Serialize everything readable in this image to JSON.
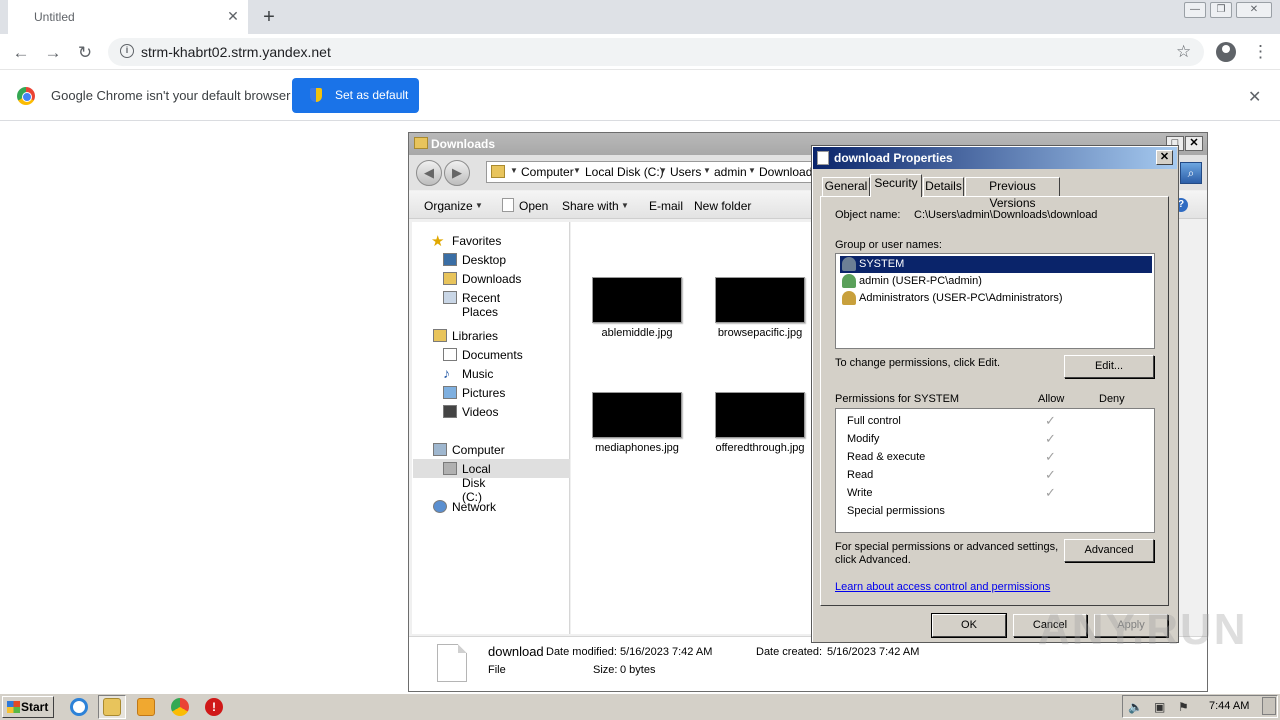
{
  "browser": {
    "tab_title": "Untitled",
    "tab_close": "✕",
    "new_tab": "+",
    "url": "strm-khabrt02.strm.yandex.net",
    "win_min": "—",
    "win_max": "❐",
    "win_close": "✕"
  },
  "infobar": {
    "message": "Google Chrome isn't your default browser",
    "button": "Set as default",
    "close": "✕"
  },
  "explorer": {
    "title": "Downloads",
    "breadcrumbs": [
      "Computer",
      "Local Disk (C:)",
      "Users",
      "admin",
      "Downloads"
    ],
    "commands": {
      "organize": "Organize",
      "open": "Open",
      "share_with": "Share with",
      "email": "E-mail",
      "new_folder": "New folder"
    },
    "nav": {
      "favorites": "Favorites",
      "desktop": "Desktop",
      "downloads": "Downloads",
      "recent_places": "Recent Places",
      "libraries": "Libraries",
      "documents": "Documents",
      "music": "Music",
      "pictures": "Pictures",
      "videos": "Videos",
      "computer": "Computer",
      "local_disk": "Local Disk (C:)",
      "network": "Network"
    },
    "files": [
      {
        "name": "ablemiddle.jpg"
      },
      {
        "name": "browsepacific.jpg"
      },
      {
        "name": "mediaphones.jpg"
      },
      {
        "name": "offeredthrough.jpg"
      }
    ],
    "details": {
      "file_name": "download",
      "file_type": "File",
      "date_modified_label": "Date modified:",
      "date_modified": "5/16/2023 7:42 AM",
      "size_label": "Size:",
      "size": "0 bytes",
      "date_created_label": "Date created:",
      "date_created": "5/16/2023 7:42 AM"
    }
  },
  "properties": {
    "title": "download Properties",
    "close": "✕",
    "tabs": [
      "General",
      "Security",
      "Details",
      "Previous Versions"
    ],
    "object_name_label": "Object name:",
    "object_name": "C:\\Users\\admin\\Downloads\\download",
    "group_label": "Group or user names:",
    "groups": [
      {
        "name": "SYSTEM"
      },
      {
        "name": "admin (USER-PC\\admin)"
      },
      {
        "name": "Administrators (USER-PC\\Administrators)"
      }
    ],
    "change_text": "To change permissions, click Edit.",
    "edit_button": "Edit...",
    "permissions_for": "Permissions for SYSTEM",
    "allow": "Allow",
    "deny": "Deny",
    "permissions": [
      {
        "name": "Full control",
        "allow": "✓"
      },
      {
        "name": "Modify",
        "allow": "✓"
      },
      {
        "name": "Read & execute",
        "allow": "✓"
      },
      {
        "name": "Read",
        "allow": "✓"
      },
      {
        "name": "Write",
        "allow": "✓"
      },
      {
        "name": "Special permissions",
        "allow": ""
      }
    ],
    "special_text_1": "For special permissions or advanced settings,",
    "special_text_2": "click Advanced.",
    "advanced_button": "Advanced",
    "learn_link": "Learn about access control and permissions",
    "ok": "OK",
    "cancel": "Cancel",
    "apply": "Apply"
  },
  "taskbar": {
    "start": "Start",
    "clock": "7:44 AM"
  },
  "watermark": "ANY.RUN",
  "colors": {
    "chrome_blue": "#1a73e8",
    "selection": "#0a246a"
  }
}
